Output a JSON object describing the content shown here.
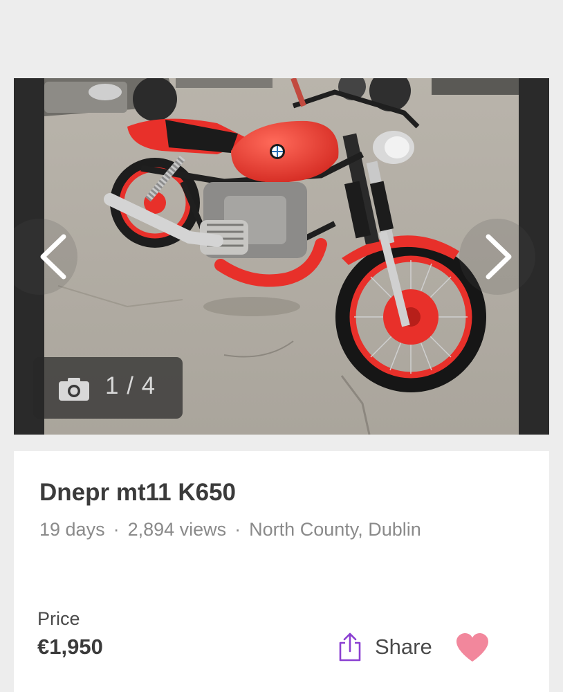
{
  "gallery": {
    "counter_text": "1 / 4",
    "prev_icon": "chevron-left-icon",
    "next_icon": "chevron-right-icon",
    "camera_icon": "camera-icon"
  },
  "listing": {
    "title": "Dnepr mt11 K650",
    "age": "19 days",
    "views": "2,894 views",
    "location": "North County, Dublin",
    "separator": "·",
    "price_label": "Price",
    "price_value": "€1,950"
  },
  "actions": {
    "share_label": "Share",
    "share_icon": "share-icon",
    "favourite_icon": "heart-icon"
  },
  "colors": {
    "accent": "#8a3fd1",
    "favourite": "#f2879c",
    "bike_red": "#e8302a"
  }
}
